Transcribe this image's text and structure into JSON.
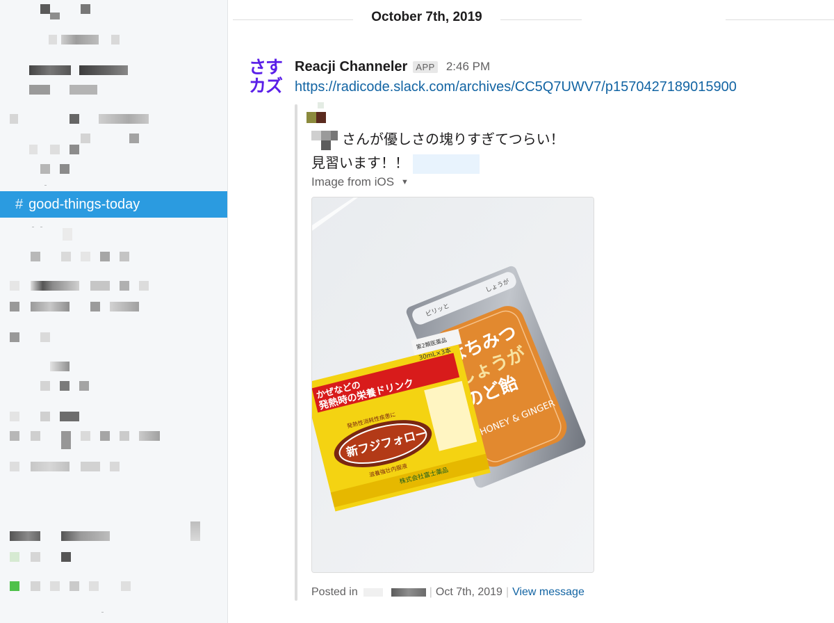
{
  "sidebar": {
    "active_channel": {
      "hash": "#",
      "name": "good-things-today"
    }
  },
  "main": {
    "date_divider": "October 7th, 2019",
    "message": {
      "avatar_text_line1": "さす",
      "avatar_text_line2": "カズ",
      "sender": "Reacji Channeler",
      "badge": "APP",
      "time": "2:46 PM",
      "link": "https://radicode.slack.com/archives/CC5Q7UWV7/p1570427189015900"
    },
    "quoted": {
      "line1": "さんが優しさの塊りすぎてつらい！",
      "line2": "見習います！！",
      "file_title": "Image from iOS",
      "footer_posted_in": "Posted in",
      "footer_date": "Oct 7th, 2019",
      "footer_view": "View message"
    },
    "photo": {
      "box_label_top": "第2類医薬品",
      "box_qty": "30mL×3本",
      "box_headline_1": "かぜなどの",
      "box_headline_2": "発熱時の栄養ドリンク",
      "box_badge": "発熱性消耗性疾患に",
      "box_product": "新フジフォロー",
      "box_sub": "滋養強壮内服液",
      "box_maker": "株式会社富士薬品",
      "pouch_top_left": "ピリッと",
      "pouch_top_right": "しょうが",
      "pouch_title_1": "はちみつ",
      "pouch_title_2": "しょうが",
      "pouch_title_3": "のど飴",
      "pouch_english": "HONEY & GINGER"
    }
  },
  "colors": {
    "accent_link": "#1264a3",
    "active_bg": "#2b9be0",
    "avatar_text": "#5a1fe8"
  }
}
